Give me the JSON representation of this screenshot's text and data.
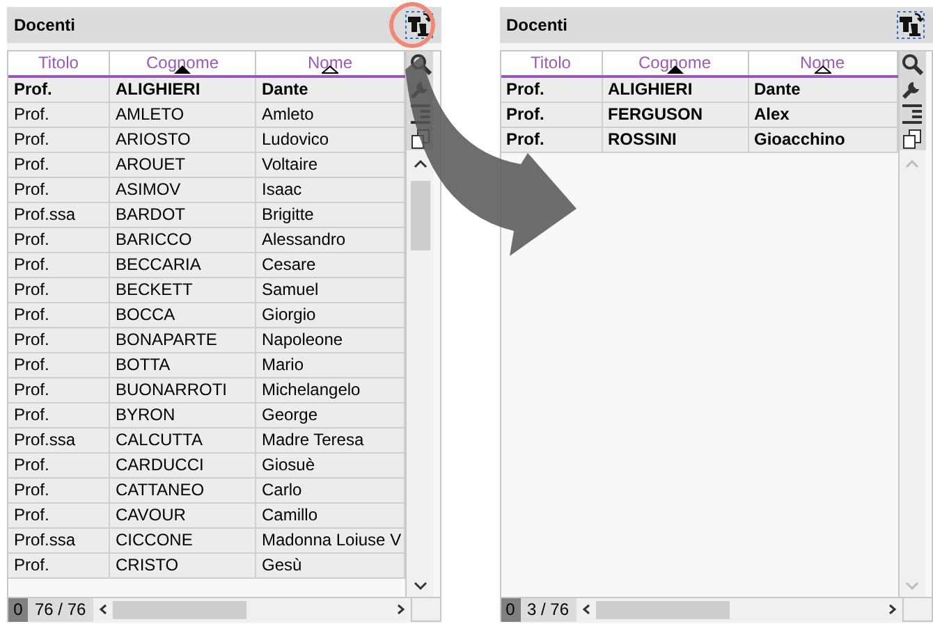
{
  "panels": [
    {
      "title": "Docenti",
      "highlighted": true,
      "columns": [
        {
          "label": "Titolo",
          "sorted": false
        },
        {
          "label": "Cognome",
          "sorted": true,
          "primary": true
        },
        {
          "label": "Nome",
          "sorted": true,
          "primary": false
        }
      ],
      "rows": [
        {
          "bold": true,
          "cells": [
            "Prof.",
            "ALIGHIERI",
            "Dante"
          ]
        },
        {
          "bold": false,
          "cells": [
            "Prof.",
            "AMLETO",
            "Amleto"
          ]
        },
        {
          "bold": false,
          "cells": [
            "Prof.",
            "ARIOSTO",
            "Ludovico"
          ]
        },
        {
          "bold": false,
          "cells": [
            "Prof.",
            "AROUET",
            "Voltaire"
          ]
        },
        {
          "bold": false,
          "cells": [
            "Prof.",
            "ASIMOV",
            "Isaac"
          ]
        },
        {
          "bold": false,
          "cells": [
            "Prof.ssa",
            "BARDOT",
            "Brigitte"
          ]
        },
        {
          "bold": false,
          "cells": [
            "Prof.",
            "BARICCO",
            "Alessandro"
          ]
        },
        {
          "bold": false,
          "cells": [
            "Prof.",
            "BECCARIA",
            "Cesare"
          ]
        },
        {
          "bold": false,
          "cells": [
            "Prof.",
            "BECKETT",
            "Samuel"
          ]
        },
        {
          "bold": false,
          "cells": [
            "Prof.",
            "BOCCA",
            "Giorgio"
          ]
        },
        {
          "bold": false,
          "cells": [
            "Prof.",
            "BONAPARTE",
            "Napoleone"
          ]
        },
        {
          "bold": false,
          "cells": [
            "Prof.",
            "BOTTA",
            "Mario"
          ]
        },
        {
          "bold": false,
          "cells": [
            "Prof.",
            "BUONARROTI",
            "Michelangelo"
          ]
        },
        {
          "bold": false,
          "cells": [
            "Prof.",
            "BYRON",
            "George"
          ]
        },
        {
          "bold": false,
          "cells": [
            "Prof.ssa",
            "CALCUTTA",
            "Madre Teresa"
          ]
        },
        {
          "bold": false,
          "cells": [
            "Prof.",
            "CARDUCCI",
            "Giosuè"
          ]
        },
        {
          "bold": false,
          "cells": [
            "Prof.",
            "CATTANEO",
            "Carlo"
          ]
        },
        {
          "bold": false,
          "cells": [
            "Prof.",
            "CAVOUR",
            "Camillo"
          ]
        },
        {
          "bold": false,
          "cells": [
            "Prof.ssa",
            "CICCONE",
            "Madonna Loiuse V"
          ]
        },
        {
          "bold": false,
          "cells": [
            "Prof.",
            "CRISTO",
            "Gesù"
          ]
        }
      ],
      "scrollable": true,
      "counter": "0",
      "count": "76 / 76"
    },
    {
      "title": "Docenti",
      "highlighted": false,
      "columns": [
        {
          "label": "Titolo",
          "sorted": false
        },
        {
          "label": "Cognome",
          "sorted": true,
          "primary": true
        },
        {
          "label": "Nome",
          "sorted": true,
          "primary": false
        }
      ],
      "rows": [
        {
          "bold": true,
          "cells": [
            "Prof.",
            "ALIGHIERI",
            "Dante"
          ]
        },
        {
          "bold": true,
          "cells": [
            "Prof.",
            "FERGUSON",
            "Alex"
          ]
        },
        {
          "bold": true,
          "cells": [
            "Prof.",
            "ROSSINI",
            "Gioacchino"
          ]
        }
      ],
      "scrollable": false,
      "counter": "0",
      "count": "3 / 76"
    }
  ]
}
